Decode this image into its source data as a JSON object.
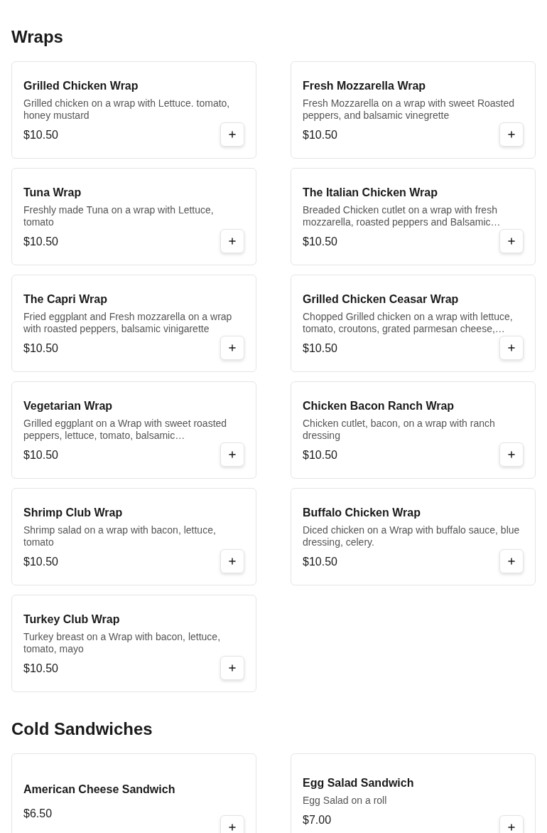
{
  "sections": [
    {
      "title": "Wraps",
      "kind": "compact",
      "items": [
        {
          "name": "Grilled Chicken Wrap",
          "description": "Grilled chicken on a wrap with Lettuce. tomato, honey mustard",
          "price": "$10.50"
        },
        {
          "name": "Fresh Mozzarella Wrap",
          "description": "Fresh Mozzarella on a wrap with sweet Roasted peppers, and balsamic vinegrette",
          "price": "$10.50"
        },
        {
          "name": "Tuna Wrap",
          "description": "Freshly made Tuna on a wrap with Lettuce, tomato",
          "price": "$10.50"
        },
        {
          "name": "The Italian Chicken Wrap",
          "description": "Breaded Chicken cutlet on a wrap with fresh mozzarella, roasted peppers and Balsamic…",
          "price": "$10.50"
        },
        {
          "name": "The Capri Wrap",
          "description": "Fried eggplant and Fresh mozzarella on a wrap with roasted peppers, balsamic vinigarette",
          "price": "$10.50"
        },
        {
          "name": "Grilled Chicken Ceasar Wrap",
          "description": "Chopped Grilled chicken on a wrap with lettuce, tomato, croutons, grated parmesan cheese,…",
          "price": "$10.50"
        },
        {
          "name": "Vegetarian Wrap",
          "description": "Grilled eggplant on a Wrap with sweet roasted peppers, lettuce, tomato, balsamic…",
          "price": "$10.50"
        },
        {
          "name": "Chicken Bacon Ranch Wrap",
          "description": "Chicken cutlet, bacon, on a wrap with ranch dressing",
          "price": "$10.50"
        },
        {
          "name": "Shrimp Club Wrap",
          "description": "Shrimp salad on a wrap with bacon, lettuce, tomato",
          "price": "$10.50"
        },
        {
          "name": "Buffalo Chicken Wrap",
          "description": "Diced chicken on a Wrap with buffalo sauce, blue dressing, celery.",
          "price": "$10.50"
        },
        {
          "name": "Turkey Club Wrap",
          "description": "Turkey breast on a Wrap with bacon, lettuce, tomato, mayo",
          "price": "$10.50"
        }
      ]
    },
    {
      "title": "Cold Sandwiches",
      "kind": "tall",
      "items": [
        {
          "name": "American Cheese Sandwich",
          "price": "$6.50"
        },
        {
          "name": "Egg Salad Sandwich",
          "description": "Egg Salad on a roll",
          "price": "$7.00"
        }
      ]
    }
  ]
}
